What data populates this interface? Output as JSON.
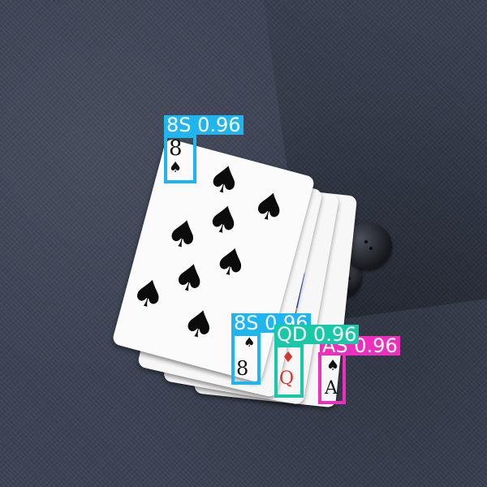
{
  "detections": [
    {
      "label": "8S 0.96",
      "color": "#1fb5ef"
    },
    {
      "label": "8S 0.96",
      "color": "#1fb5ef"
    },
    {
      "label": "QD 0.96",
      "color": "#17c9a6"
    },
    {
      "label": "AS 0.96",
      "color": "#ee2fbd"
    }
  ],
  "cards": {
    "front": {
      "rank": "8",
      "suit": "spade-icon"
    },
    "second": {
      "rank": "8",
      "suit": "spade-icon"
    },
    "third": {
      "rank": "Q",
      "suit": "diamond-icon"
    },
    "fourth": {
      "rank": "A",
      "suit": "spade-icon"
    }
  },
  "glyphs": {
    "spade": "♠",
    "diamond": "♦",
    "eight": "8",
    "queen": "Q",
    "ace": "A"
  }
}
